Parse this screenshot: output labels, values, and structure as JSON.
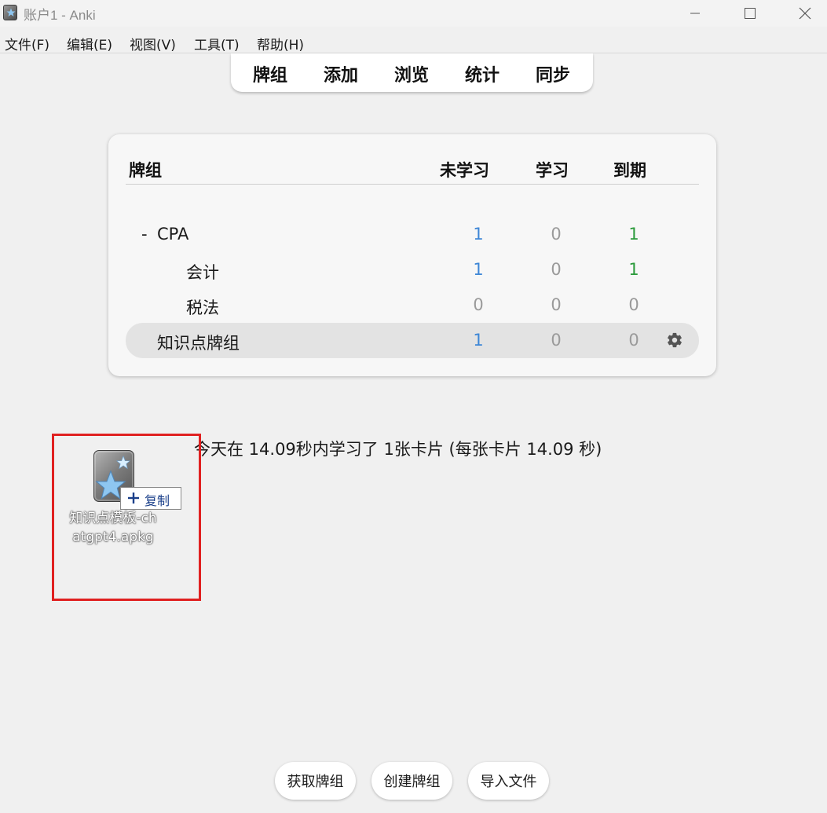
{
  "window": {
    "title": "账户1 - Anki"
  },
  "menu": [
    "文件(F)",
    "编辑(E)",
    "视图(V)",
    "工具(T)",
    "帮助(H)"
  ],
  "toolbar": {
    "decks": "牌组",
    "add": "添加",
    "browse": "浏览",
    "stats": "统计",
    "sync": "同步"
  },
  "deck_table": {
    "headers": {
      "deck": "牌组",
      "new": "未学习",
      "learn": "学习",
      "due": "到期"
    },
    "rows": [
      {
        "collapse": "-",
        "name": "CPA",
        "new": "1",
        "learn": "0",
        "due": "1"
      },
      {
        "collapse": "",
        "name": "会计",
        "new": "1",
        "learn": "0",
        "due": "1"
      },
      {
        "collapse": "",
        "name": "税法",
        "new": "0",
        "learn": "0",
        "due": "0"
      },
      {
        "collapse": "",
        "name": "知识点牌组",
        "new": "1",
        "learn": "0",
        "due": "0"
      }
    ]
  },
  "stats_line": "今天在 14.09秒内学习了 1张卡片  (每张卡片 14.09 秒)",
  "drag": {
    "copy_label": "复制",
    "file_name": "知识点模板-chatgpt4.apkg"
  },
  "bottom_buttons": {
    "get_shared": "获取牌组",
    "create_deck": "创建牌组",
    "import_file": "导入文件"
  },
  "colors": {
    "new": "#3d86d6",
    "learn": "#9a9a9a",
    "due_active": "#2a9a3a",
    "zero": "#9a9a9a",
    "drag_border": "#e02020"
  }
}
